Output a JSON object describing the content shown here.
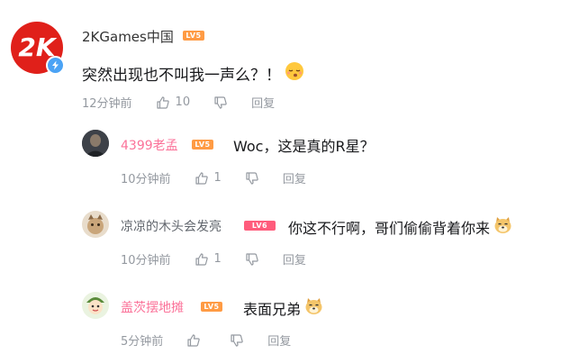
{
  "comment": {
    "username": "2KGames中国",
    "level": "LV5",
    "text": "突然出现也不叫我一声么？！",
    "emoji": "sleepy-face-emoji",
    "time": "12分钟前",
    "likes": "10",
    "reply_label": "回复"
  },
  "replies": [
    {
      "username": "4399老孟",
      "level": "LV5",
      "text": "Woc，这是真的R星？",
      "time": "10分钟前",
      "likes": "1",
      "reply_label": "回复"
    },
    {
      "username": "凉凉的木头会发亮",
      "level": "LV6",
      "text": "你这不行啊，哥们偷偷背着你来",
      "emoji": "doge-emoji",
      "time": "10分钟前",
      "likes": "1",
      "reply_label": "回复"
    },
    {
      "username": "盖茨摆地摊",
      "level": "LV5",
      "text": "表面兄弟",
      "emoji": "doge-emoji",
      "time": "5分钟前",
      "likes": "",
      "reply_label": "回复"
    }
  ],
  "colors": {
    "pink_name": "#fb7299",
    "lv5": "#ff9b44",
    "lv6": "#ff5c7c",
    "meta": "#9499a0",
    "verified": "#4ba3f5"
  }
}
